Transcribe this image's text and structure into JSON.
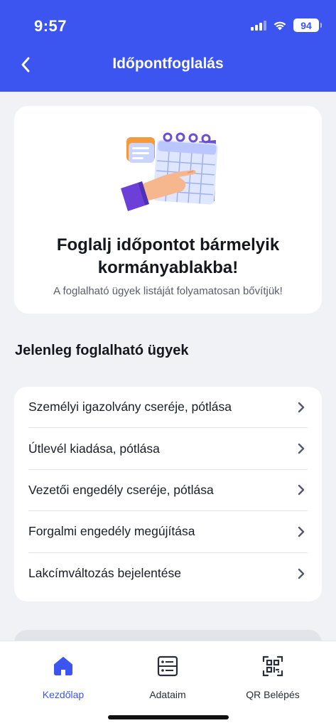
{
  "status_bar": {
    "time": "9:57",
    "battery": "94"
  },
  "header": {
    "title": "Időpontfoglalás",
    "back_icon": "chevron-left-icon"
  },
  "hero": {
    "title": "Foglalj időpontot bármelyik kormányablakba!",
    "subtitle": "A foglalható ügyek listáját folyamatosan bővítjük!"
  },
  "section": {
    "title": "Jelenleg foglalható ügyek"
  },
  "services": [
    {
      "label": "Személyi igazolvány cseréje, pótlása"
    },
    {
      "label": "Útlevél kiadása, pótlása"
    },
    {
      "label": "Vezetői engedély cseréje, pótlása"
    },
    {
      "label": "Forgalmi engedély megújítása"
    },
    {
      "label": "Lakcímváltozás bejelentése"
    }
  ],
  "tabs": [
    {
      "label": "Kezdőlap",
      "icon": "home-icon",
      "active": true
    },
    {
      "label": "Adataim",
      "icon": "id-card-icon",
      "active": false
    },
    {
      "label": "QR Belépés",
      "icon": "qr-scan-icon",
      "active": false
    }
  ],
  "colors": {
    "accent": "#3c54f0",
    "background": "#f1f2f6",
    "card": "#ffffff"
  }
}
